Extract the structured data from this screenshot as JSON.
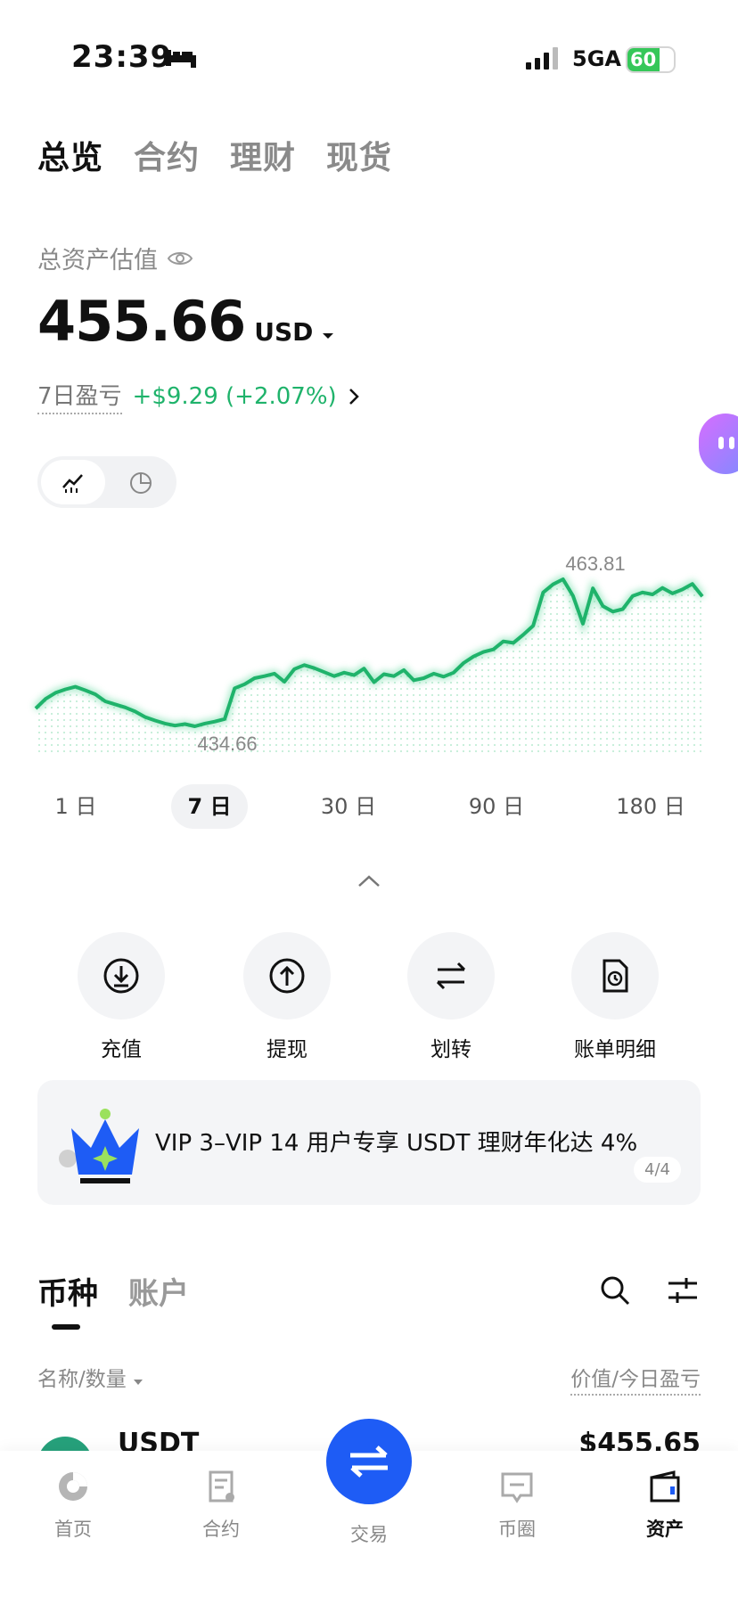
{
  "status_bar": {
    "time": "23:39",
    "network": "5GA",
    "battery": "60"
  },
  "top_tabs": [
    {
      "label": "总览",
      "active": true
    },
    {
      "label": "合约",
      "active": false
    },
    {
      "label": "理财",
      "active": false
    },
    {
      "label": "现货",
      "active": false
    }
  ],
  "overview": {
    "total_label": "总资产估值",
    "total_value": "455.66",
    "currency": "USD",
    "pnl_label": "7日盈亏",
    "pnl_value": "+$9.29 (+2.07%)"
  },
  "chart_data": {
    "type": "area",
    "title": "",
    "xlabel": "",
    "ylabel": "",
    "ylim": [
      434.66,
      463.81
    ],
    "annotations": {
      "max": "463.81",
      "min": "434.66"
    },
    "values": [
      438.2,
      440.1,
      441.3,
      442.0,
      442.5,
      441.8,
      441.0,
      439.6,
      439.0,
      438.4,
      437.6,
      436.5,
      435.8,
      435.2,
      434.8,
      435.1,
      434.66,
      435.2,
      435.6,
      436.1,
      442.2,
      443.0,
      444.2,
      444.6,
      445.1,
      443.5,
      446.0,
      446.8,
      446.2,
      445.4,
      444.6,
      445.3,
      444.8,
      446.1,
      443.4,
      445.0,
      444.6,
      445.8,
      443.8,
      444.2,
      445.1,
      444.5,
      445.3,
      447.2,
      448.5,
      449.4,
      449.9,
      451.5,
      451.2,
      452.8,
      454.6,
      461.2,
      462.8,
      463.81,
      460.5,
      455.0,
      462.0,
      458.5,
      457.4,
      457.9,
      460.5,
      461.2,
      460.8,
      462.1,
      461.0,
      461.8,
      462.9,
      460.4
    ],
    "grid": false
  },
  "ranges": [
    {
      "label": "1 日",
      "active": false
    },
    {
      "label": "7 日",
      "active": true
    },
    {
      "label": "30 日",
      "active": false
    },
    {
      "label": "90 日",
      "active": false
    },
    {
      "label": "180 日",
      "active": false
    }
  ],
  "actions": [
    {
      "label": "充值",
      "icon": "deposit-icon"
    },
    {
      "label": "提现",
      "icon": "withdraw-icon"
    },
    {
      "label": "划转",
      "icon": "transfer-icon"
    },
    {
      "label": "账单明细",
      "icon": "bill-icon"
    }
  ],
  "banner": {
    "text": "VIP 3–VIP 14 用户专享 USDT 理财年化达 4%",
    "count": "4/4"
  },
  "list": {
    "tabs": [
      {
        "label": "币种",
        "active": true
      },
      {
        "label": "账户",
        "active": false
      }
    ],
    "col_left": "名称/数量",
    "col_right": "价值/今日盈亏",
    "rows": [
      {
        "name": "USDT",
        "value": "$455.65"
      }
    ]
  },
  "bottom_nav": [
    {
      "label": "首页",
      "icon": "home-icon",
      "active": false
    },
    {
      "label": "合约",
      "icon": "contract-icon",
      "active": false
    },
    {
      "label": "交易",
      "icon": "trade-icon",
      "active": false
    },
    {
      "label": "币圈",
      "icon": "community-icon",
      "active": false
    },
    {
      "label": "资产",
      "icon": "assets-icon",
      "active": true
    }
  ],
  "colors": {
    "accent": "#1fb36b",
    "primary": "#1e5cf5"
  }
}
